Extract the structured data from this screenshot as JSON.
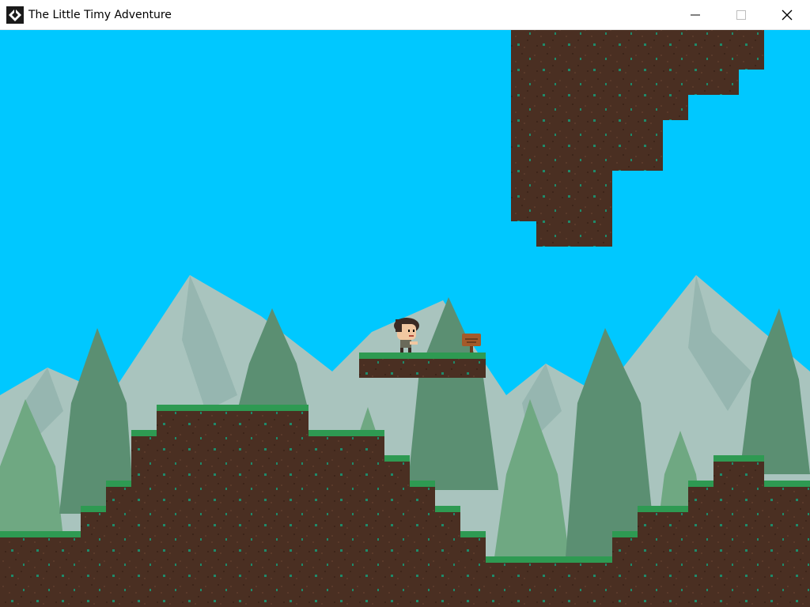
{
  "window": {
    "title": "The Little Timy Adventure",
    "app_icon": "game-engine-logo-icon",
    "controls": {
      "minimize_icon": "minimize-icon",
      "maximize_icon": "maximize-icon",
      "close_icon": "close-icon"
    }
  },
  "scene": {
    "sky_color": "#00c8ff",
    "mountain_color": "#a9c4be",
    "mountain_shadow_color": "#8fb0a9",
    "tree_dark_color": "#5b8f72",
    "tree_light_color": "#6fa882",
    "dirt_color": "#4a2f22",
    "grass_color": "#2e9a52",
    "gem_color": "#1f8a6a",
    "player": "timy-character",
    "signpost": "wooden-signpost"
  }
}
